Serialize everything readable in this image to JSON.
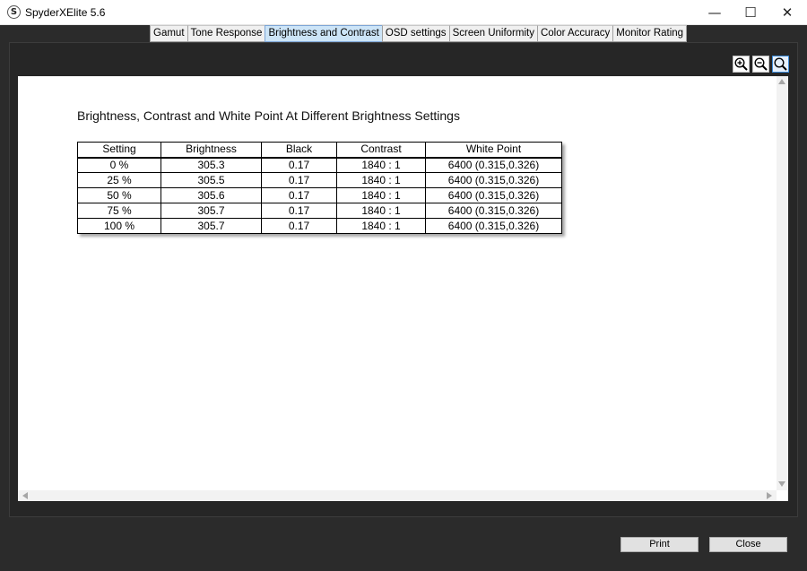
{
  "window": {
    "title": "SpyderXElite 5.6",
    "app_icon_letter": "S",
    "controls": {
      "minimize": "—",
      "maximize": "☐",
      "close": "✕"
    }
  },
  "tabs": [
    {
      "label": "Gamut",
      "active": false
    },
    {
      "label": "Tone Response",
      "active": false
    },
    {
      "label": "Brightness and Contrast",
      "active": true
    },
    {
      "label": "OSD settings",
      "active": false
    },
    {
      "label": "Screen Uniformity",
      "active": false
    },
    {
      "label": "Color Accuracy",
      "active": false
    },
    {
      "label": "Monitor Rating",
      "active": false
    }
  ],
  "toolbar": {
    "icons": [
      "zoom-in-icon",
      "zoom-out-icon",
      "zoom-fit-icon"
    ]
  },
  "report": {
    "title": "Brightness, Contrast and White Point At Different Brightness Settings",
    "columns": [
      "Setting",
      "Brightness",
      "Black",
      "Contrast",
      "White Point"
    ],
    "rows": [
      [
        "0 %",
        "305.3",
        "0.17",
        "1840 : 1",
        "6400 (0.315,0.326)"
      ],
      [
        "25 %",
        "305.5",
        "0.17",
        "1840 : 1",
        "6400 (0.315,0.326)"
      ],
      [
        "50 %",
        "305.6",
        "0.17",
        "1840 : 1",
        "6400 (0.315,0.326)"
      ],
      [
        "75 %",
        "305.7",
        "0.17",
        "1840 : 1",
        "6400 (0.315,0.326)"
      ],
      [
        "100 %",
        "305.7",
        "0.17",
        "1840 : 1",
        "6400 (0.315,0.326)"
      ]
    ]
  },
  "buttons": {
    "print": "Print",
    "close": "Close"
  },
  "colors": {
    "active_tab": "#cce4f7",
    "panel_bg": "#262626"
  }
}
